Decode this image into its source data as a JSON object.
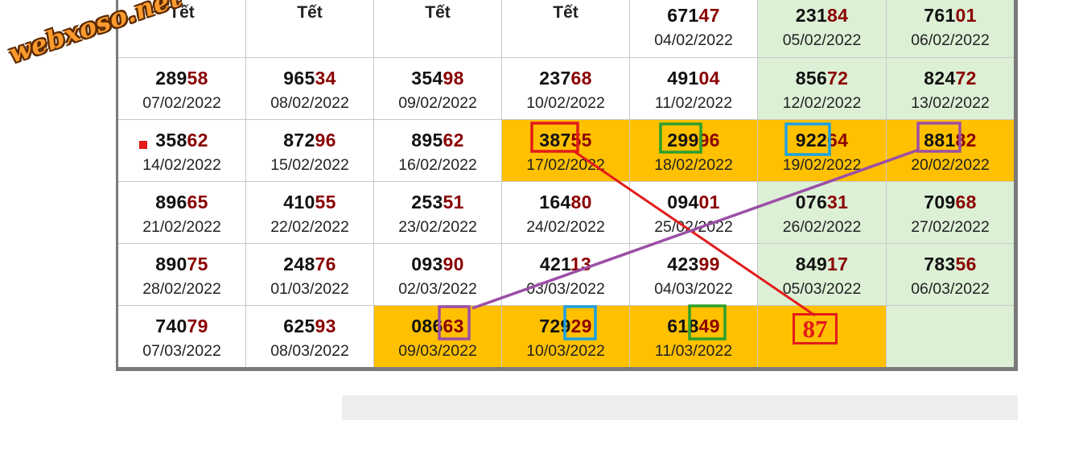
{
  "watermark": "webxoso.net",
  "result_badge": "87",
  "colors": {
    "green_cell": "#dcf0d6",
    "orange_cell": "#ffc000",
    "tail_digits": "#8b0000",
    "red_box": "#e31b1b",
    "green_box": "#2ca02c",
    "blue_box": "#1ba1e2",
    "purple_box": "#9b4fa6"
  },
  "rows": [
    [
      {
        "tet": "Tết"
      },
      {
        "tet": "Tết"
      },
      {
        "tet": "Tết"
      },
      {
        "tet": "Tết"
      },
      {
        "head": "671",
        "tail": "47",
        "date": "04/02/2022"
      },
      {
        "head": "231",
        "tail": "84",
        "date": "05/02/2022",
        "bg": "green"
      },
      {
        "head": "761",
        "tail": "01",
        "date": "06/02/2022",
        "bg": "green"
      }
    ],
    [
      {
        "head": "289",
        "tail": "58",
        "date": "07/02/2022"
      },
      {
        "head": "965",
        "tail": "34",
        "date": "08/02/2022"
      },
      {
        "head": "354",
        "tail": "98",
        "date": "09/02/2022"
      },
      {
        "head": "237",
        "tail": "68",
        "date": "10/02/2022"
      },
      {
        "head": "491",
        "tail": "04",
        "date": "11/02/2022"
      },
      {
        "head": "856",
        "tail": "72",
        "date": "12/02/2022",
        "bg": "green"
      },
      {
        "head": "824",
        "tail": "72",
        "date": "13/02/2022",
        "bg": "green"
      }
    ],
    [
      {
        "head": "358",
        "tail": "62",
        "date": "14/02/2022",
        "marker": true
      },
      {
        "head": "872",
        "tail": "96",
        "date": "15/02/2022"
      },
      {
        "head": "895",
        "tail": "62",
        "date": "16/02/2022"
      },
      {
        "head": "387",
        "tail": "55",
        "date": "17/02/2022",
        "bg": "orange"
      },
      {
        "head": "299",
        "tail": "96",
        "date": "18/02/2022",
        "bg": "orange"
      },
      {
        "head": "922",
        "tail": "64",
        "date": "19/02/2022",
        "bg": "orange"
      },
      {
        "head": "881",
        "tail": "82",
        "date": "20/02/2022",
        "bg": "orange"
      }
    ],
    [
      {
        "head": "896",
        "tail": "65",
        "date": "21/02/2022"
      },
      {
        "head": "410",
        "tail": "55",
        "date": "22/02/2022"
      },
      {
        "head": "253",
        "tail": "51",
        "date": "23/02/2022"
      },
      {
        "head": "164",
        "tail": "80",
        "date": "24/02/2022"
      },
      {
        "head": "094",
        "tail": "01",
        "date": "25/02/2022"
      },
      {
        "head": "076",
        "tail": "31",
        "date": "26/02/2022",
        "bg": "green"
      },
      {
        "head": "709",
        "tail": "68",
        "date": "27/02/2022",
        "bg": "green"
      }
    ],
    [
      {
        "head": "890",
        "tail": "75",
        "date": "28/02/2022"
      },
      {
        "head": "248",
        "tail": "76",
        "date": "01/03/2022"
      },
      {
        "head": "093",
        "tail": "90",
        "date": "02/03/2022"
      },
      {
        "head": "421",
        "tail": "13",
        "date": "03/03/2022"
      },
      {
        "head": "423",
        "tail": "99",
        "date": "04/03/2022"
      },
      {
        "head": "849",
        "tail": "17",
        "date": "05/03/2022",
        "bg": "green"
      },
      {
        "head": "783",
        "tail": "56",
        "date": "06/03/2022",
        "bg": "green"
      }
    ],
    [
      {
        "head": "740",
        "tail": "79",
        "date": "07/03/2022"
      },
      {
        "head": "625",
        "tail": "93",
        "date": "08/03/2022"
      },
      {
        "head": "086",
        "tail": "63",
        "date": "09/03/2022",
        "bg": "orange"
      },
      {
        "head": "729",
        "tail": "29",
        "date": "10/03/2022",
        "bg": "orange"
      },
      {
        "head": "618",
        "tail": "49",
        "date": "11/03/2022",
        "bg": "orange"
      },
      {
        "empty": true,
        "bg": "orange"
      },
      {
        "empty": true,
        "bg": "green"
      }
    ]
  ]
}
